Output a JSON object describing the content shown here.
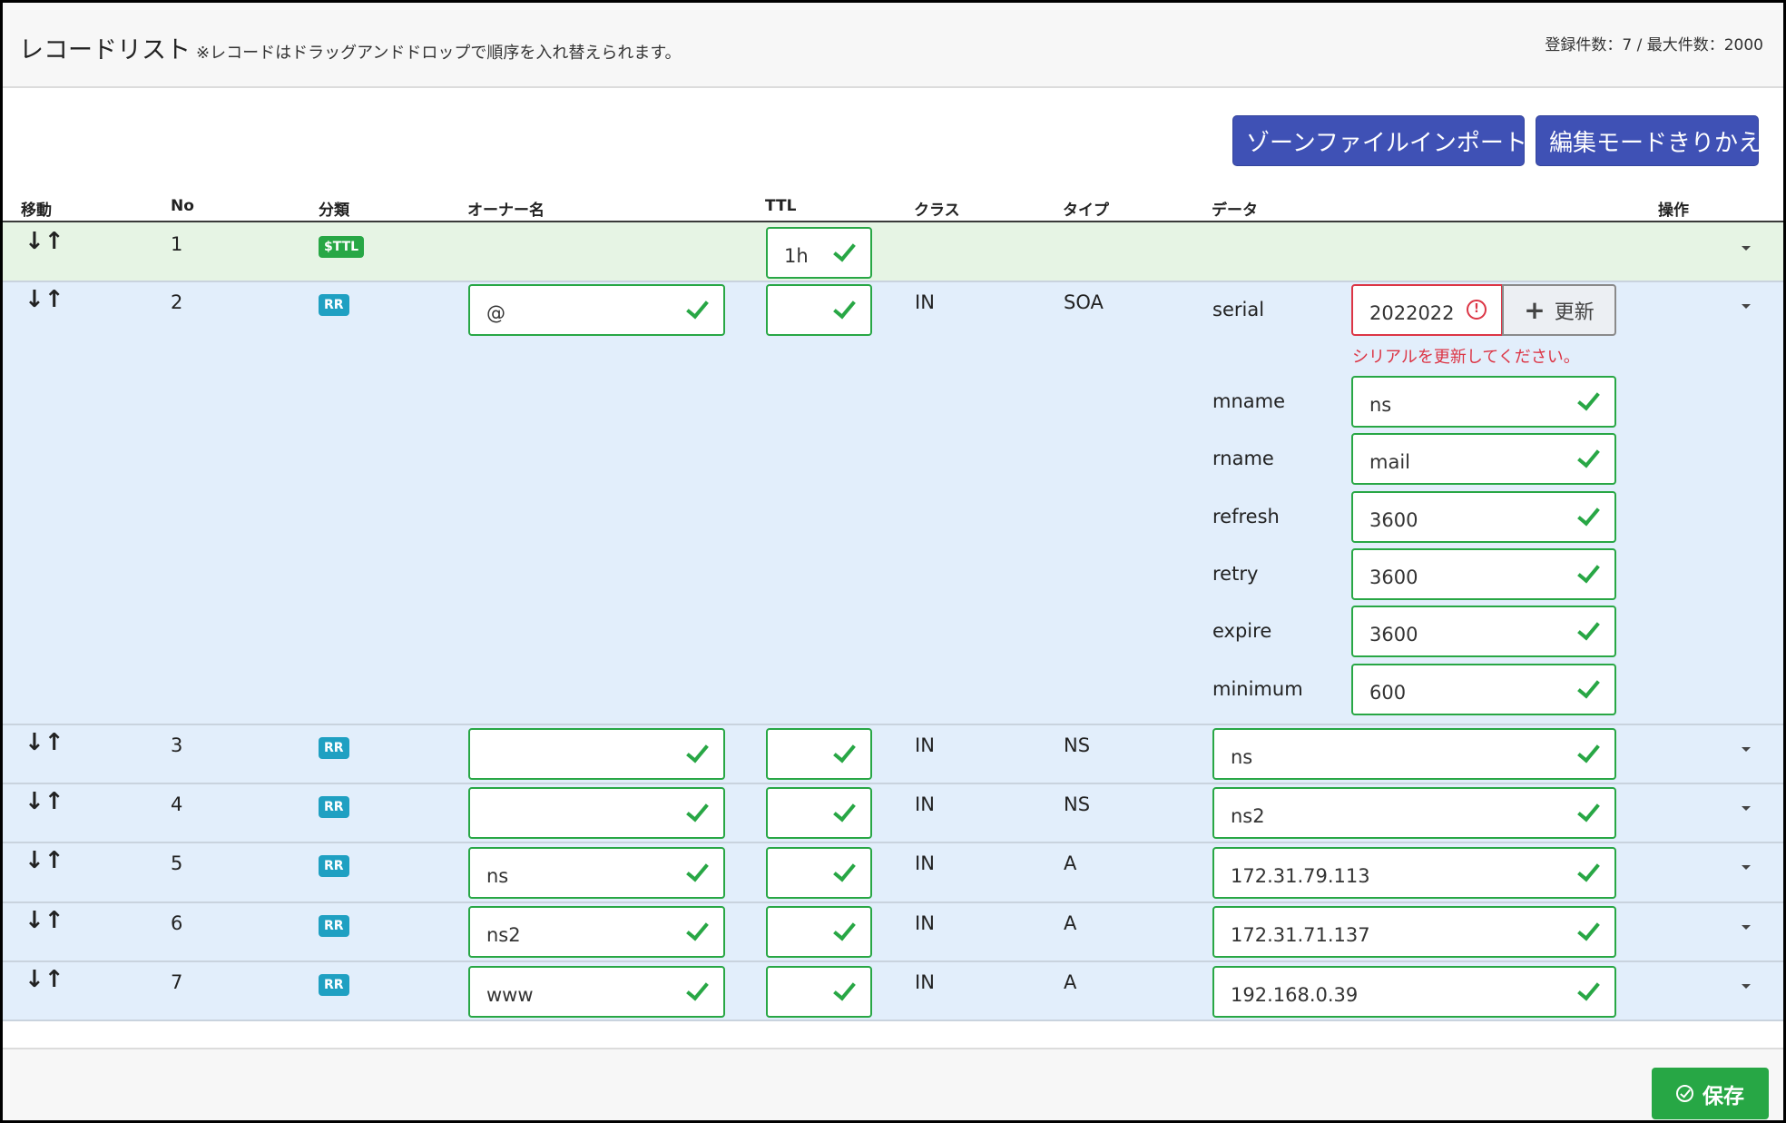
{
  "header": {
    "title": "レコードリスト",
    "note": "※レコードはドラッグアンドドロップで順序を入れ替えられます。",
    "count": "登録件数：7 / 最大件数：2000"
  },
  "toolbar": {
    "import_label": "ゾーンファイルインポート",
    "edit_mode_label": "編集モードきりかえ"
  },
  "columns": {
    "move": "移動",
    "no": "No",
    "category": "分類",
    "owner": "オーナー名",
    "ttl": "TTL",
    "class": "クラス",
    "type": "タイプ",
    "data": "データ",
    "ops": "操作"
  },
  "icons": {
    "move": "↓↑",
    "check": "check-icon",
    "caret": "caret-down-icon",
    "warning": "!"
  },
  "rows": [
    {
      "no": "1",
      "badge": "$TTL",
      "ttl": "1h"
    },
    {
      "no": "2",
      "badge": "RR",
      "owner": "@",
      "ttl": "",
      "class": "IN",
      "type": "SOA",
      "soa": {
        "serial_label": "serial",
        "serial_value": "2022022",
        "update_label": "更新",
        "serial_error": "シリアルを更新してください。",
        "fields": [
          {
            "label": "mname",
            "value": "ns"
          },
          {
            "label": "rname",
            "value": "mail"
          },
          {
            "label": "refresh",
            "value": "3600"
          },
          {
            "label": "retry",
            "value": "3600"
          },
          {
            "label": "expire",
            "value": "3600"
          },
          {
            "label": "minimum",
            "value": "600"
          }
        ]
      }
    },
    {
      "no": "3",
      "badge": "RR",
      "owner": "",
      "ttl": "",
      "class": "IN",
      "type": "NS",
      "data": "ns"
    },
    {
      "no": "4",
      "badge": "RR",
      "owner": "",
      "ttl": "",
      "class": "IN",
      "type": "NS",
      "data": "ns2"
    },
    {
      "no": "5",
      "badge": "RR",
      "owner": "ns",
      "ttl": "",
      "class": "IN",
      "type": "A",
      "data": "172.31.79.113"
    },
    {
      "no": "6",
      "badge": "RR",
      "owner": "ns2",
      "ttl": "",
      "class": "IN",
      "type": "A",
      "data": "172.31.71.137"
    },
    {
      "no": "7",
      "badge": "RR",
      "owner": "www",
      "ttl": "",
      "class": "IN",
      "type": "A",
      "data": "192.168.0.39"
    }
  ],
  "footer": {
    "save_label": "保存"
  },
  "colors": {
    "primary": "#3f51b5",
    "success": "#28a745",
    "danger": "#dc3545",
    "ttl_row": "#e6f4e4",
    "rr_row": "#e2eefb"
  }
}
